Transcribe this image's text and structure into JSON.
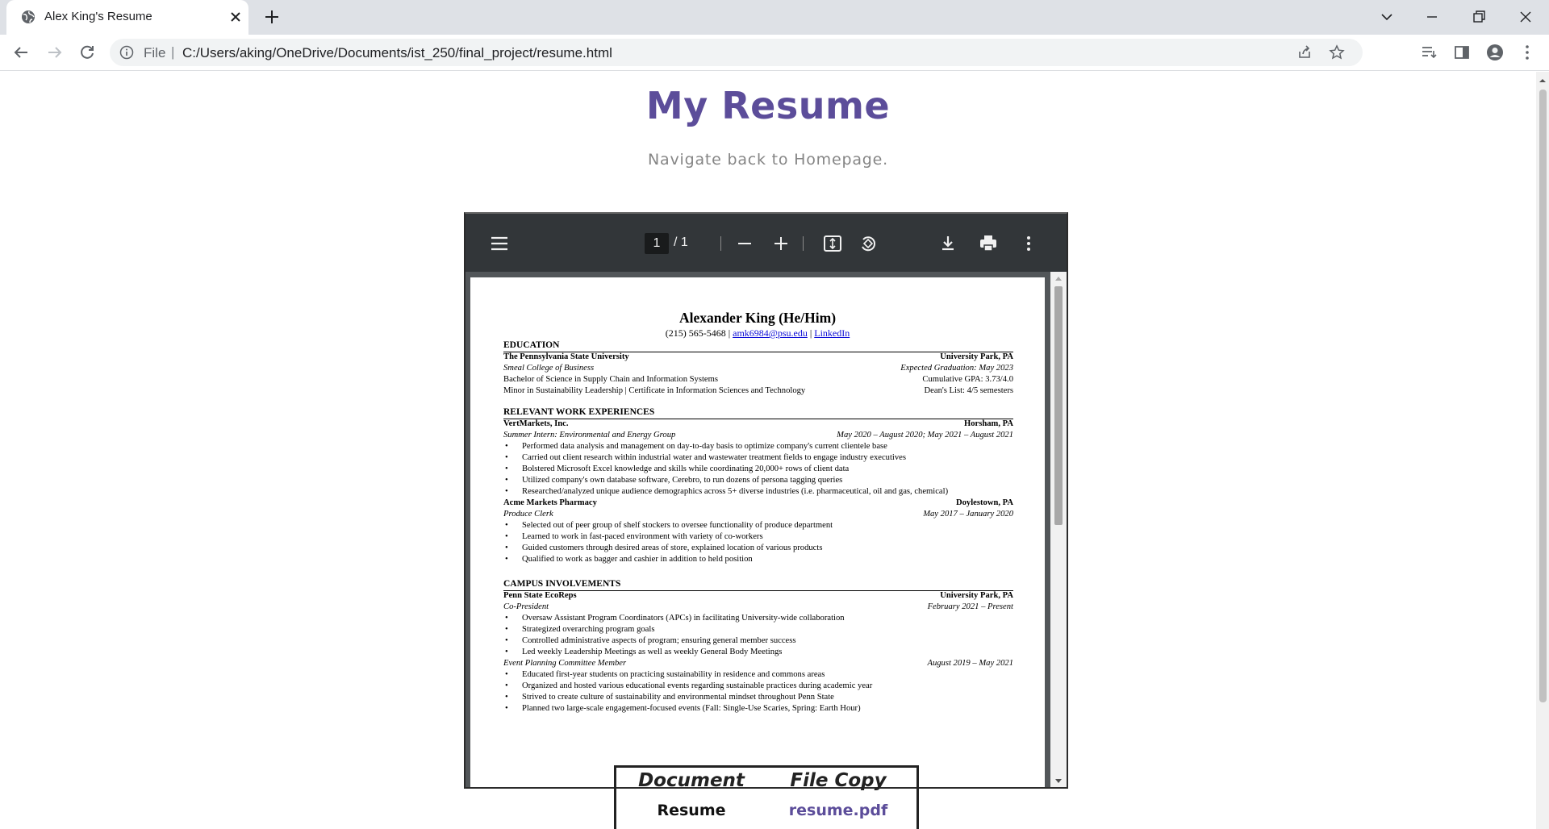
{
  "browser": {
    "tab_title": "Alex King's Resume",
    "omnibox_scheme": "File",
    "omnibox_separator": "|",
    "url": "C:/Users/aking/OneDrive/Documents/ist_250/final_project/resume.html"
  },
  "page": {
    "title": "My Resume",
    "home_link": "Navigate back to Homepage."
  },
  "pdf_viewer": {
    "current_page": "1",
    "page_total": "/  1"
  },
  "resume": {
    "name": "Alexander King (He/Him)",
    "phone": "(215) 565-5468 |",
    "email": "amk6984@psu.edu",
    "separator": "|",
    "linkedin": "LinkedIn",
    "education": {
      "heading": "EDUCATION",
      "school": "The Pennsylvania State University",
      "school_location": "University Park, PA",
      "college": "Smeal College of Business",
      "graduation": "Expected Graduation: May 2023",
      "degree": "Bachelor of Science in Supply Chain and Information Systems",
      "gpa": "Cumulative GPA: 3.73/4.0",
      "minor": "Minor in Sustainability Leadership | Certificate in Information Sciences and Technology",
      "deans_list": "Dean's List: 4/5 semesters"
    },
    "work": {
      "heading": "RELEVANT WORK EXPERIENCES",
      "jobs": [
        {
          "company": "VertMarkets, Inc.",
          "location": "Horsham, PA",
          "role": "Summer Intern: Environmental and Energy Group",
          "dates": "May 2020 – August 2020; May 2021 – August 2021",
          "bullets": [
            "Performed data analysis and management on day-to-day basis to optimize company's current clientele base",
            "Carried out client research within industrial water and wastewater treatment fields to engage industry executives",
            "Bolstered Microsoft Excel knowledge and skills while coordinating 20,000+ rows of client data",
            "Utilized company's own database software, Cerebro, to run dozens of persona tagging queries",
            "Researched/analyzed unique audience demographics across 5+ diverse industries (i.e. pharmaceutical, oil and gas, chemical)"
          ]
        },
        {
          "company": "Acme Markets Pharmacy",
          "location": "Doylestown, PA",
          "role": "Produce Clerk",
          "dates": "May 2017 – January 2020",
          "bullets": [
            "Selected out of peer group of shelf stockers to oversee functionality of produce department",
            "Learned to work in fast-paced environment with variety of co-workers",
            "Guided customers through desired areas of store, explained location of various products",
            "Qualified to work as bagger and cashier in addition to held position"
          ]
        }
      ]
    },
    "campus": {
      "heading": "CAMPUS INVOLVEMENTS",
      "org": "Penn State EcoReps",
      "org_location": "University Park, PA",
      "role1": "Co-President",
      "role1_dates": "February 2021 – Present",
      "role1_bullets": [
        "Oversaw Assistant Program Coordinators (APCs) in facilitating University-wide collaboration",
        "Strategized overarching program goals",
        "Controlled administrative aspects of program; ensuring general member success",
        "Led weekly Leadership Meetings as well as weekly General Body Meetings"
      ],
      "role2": "Event Planning Committee Member",
      "role2_dates": "August 2019 – May 2021",
      "role2_bullets": [
        "Educated first-year students on practicing sustainability in residence and commons areas",
        "Organized and hosted various educational events regarding sustainable practices during academic year",
        "Strived to create culture of sustainability and environmental mindset throughout Penn State",
        "Planned two large-scale engagement-focused events (Fall: Single-Use Scaries, Spring: Earth Hour)"
      ]
    }
  },
  "file_table": {
    "headers": [
      "Document",
      "File Copy"
    ],
    "rows": [
      [
        "Resume",
        "resume.pdf"
      ]
    ]
  },
  "colors": {
    "title": "#5c4d9a",
    "link": "#5c4d9a",
    "pdf_toolbar": "#323639"
  }
}
